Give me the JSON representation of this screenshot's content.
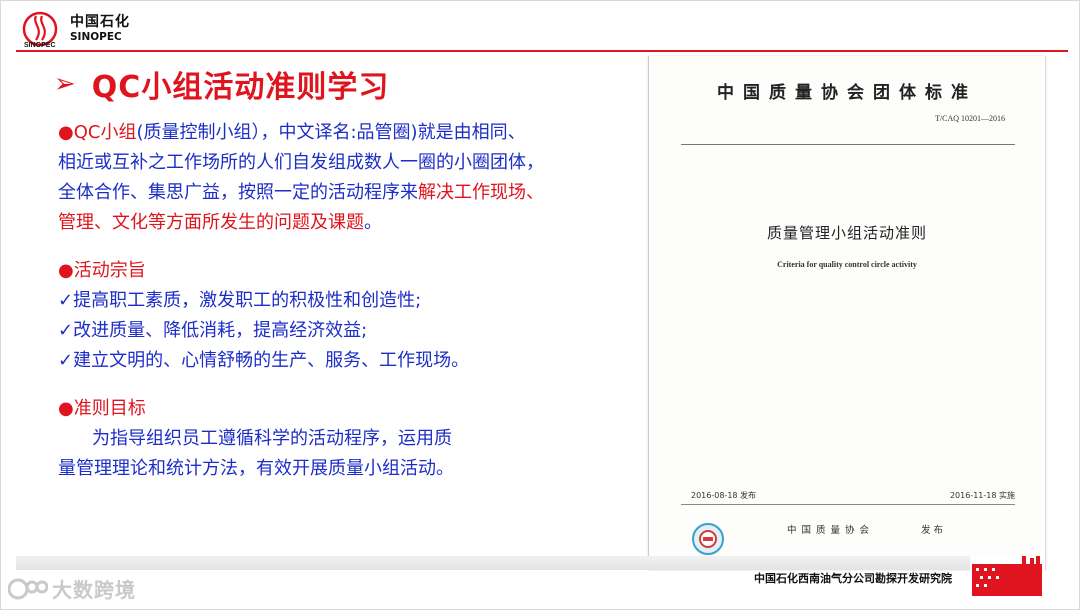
{
  "header": {
    "brand_cn": "中国石化",
    "brand_en": "SINOPEC"
  },
  "title": {
    "arrow": "➢",
    "text": "QC小组活动准则学习"
  },
  "body": {
    "intro": {
      "bullet": "●",
      "qc_term": "QC小组",
      "part1": "(质量控制小组），中文译名:品管圈)就是由相同、",
      "line2": "相近或互补之工作场所的人们自发组成数人一圈的小圈团体，",
      "line3_plain": "全体合作、集思广益，按照一定的活动程序来",
      "line3_red": "解决工作现场、",
      "line4_red": "管理、文化等方面所发生的问题及课题",
      "line4_end": "。"
    },
    "purpose": {
      "bullet": "●",
      "heading": "活动宗旨",
      "items": [
        "✓提高职工素质，激发职工的积极性和创造性;",
        "✓改进质量、降低消耗，提高经济效益;",
        "✓建立文明的、心情舒畅的生产、服务、工作现场。"
      ]
    },
    "goal": {
      "bullet": "●",
      "heading": "准则目标",
      "line1": "为指导组织员工遵循科学的活动程序，运用质",
      "line2": "量管理理论和统计方法，有效开展质量小组活动。"
    }
  },
  "document": {
    "org": "中国质量协会团体标准",
    "code": "T/CAQ 10201—2016",
    "title_cn": "质量管理小组活动准则",
    "title_en": "Criteria for quality control circle activity",
    "release_date": "2016-08-18 发布",
    "effective_date": "2016-11-18 实施",
    "issuer": "中国质量协会",
    "issue_word": "发布"
  },
  "footer": {
    "institute": "中国石化西南油气分公司勘探开发研究院",
    "watermark": "大数跨境"
  },
  "colors": {
    "accent_red": "#e0141e",
    "body_blue": "#1d2ec8"
  }
}
